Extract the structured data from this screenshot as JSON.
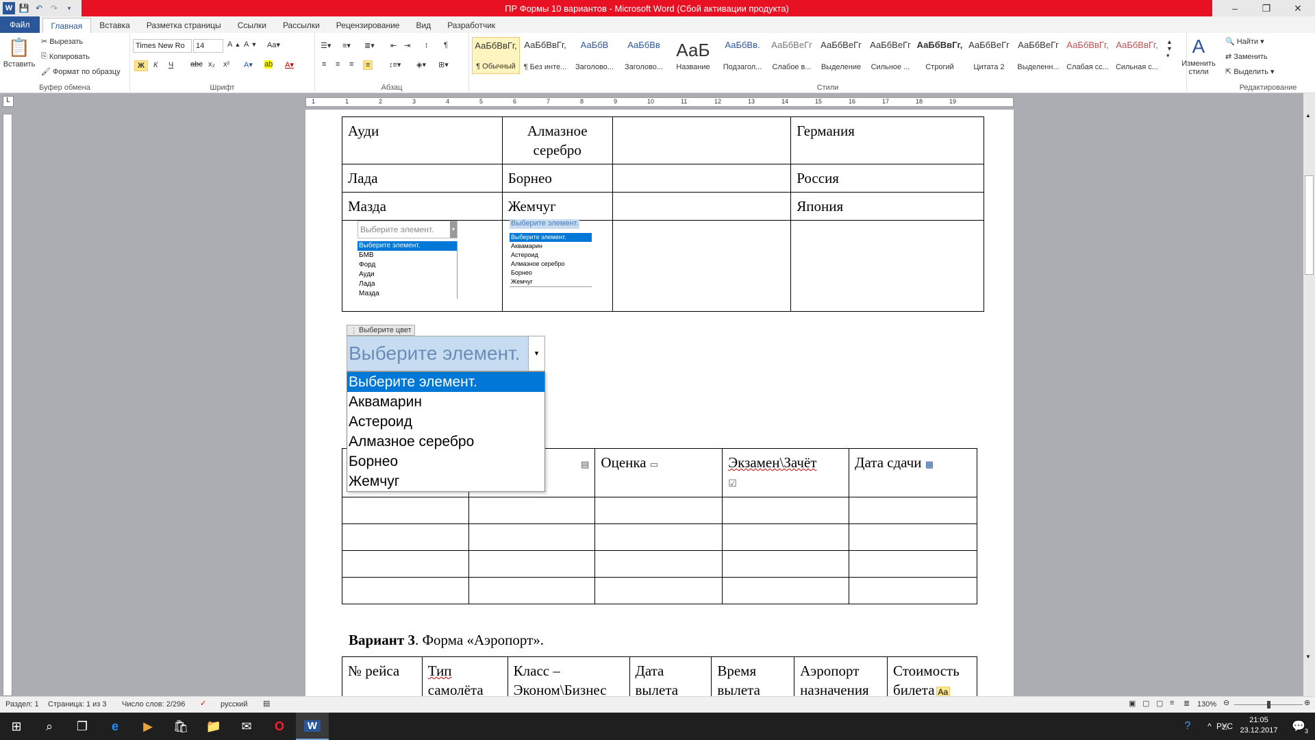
{
  "window": {
    "title": "ПР Формы 10 вариантов  -  Microsoft Word (Сбой активации продукта)",
    "minimize": "–",
    "restore": "❐",
    "close": "✕"
  },
  "tabs": [
    "Файл",
    "Главная",
    "Вставка",
    "Разметка страницы",
    "Ссылки",
    "Рассылки",
    "Рецензирование",
    "Вид",
    "Разработчик"
  ],
  "clipboard": {
    "paste": "Вставить",
    "cut": "Вырезать",
    "copy": "Копировать",
    "format": "Формат по образцу",
    "label": "Буфер обмена"
  },
  "font": {
    "name": "Times New Ro",
    "size": "14",
    "label": "Шрифт",
    "bold": "Ж",
    "italic": "К",
    "underline": "Ч",
    "strike": "abc",
    "sub": "x₂",
    "sup": "x²"
  },
  "paragraph": {
    "label": "Абзац"
  },
  "styles": {
    "label": "Стили",
    "items": [
      {
        "preview": "АаБбВвГг,",
        "name": "¶ Обычный"
      },
      {
        "preview": "АаБбВвГг,",
        "name": "¶ Без инте..."
      },
      {
        "preview": "АаБбВ",
        "name": "Заголово..."
      },
      {
        "preview": "АаБбВв",
        "name": "Заголово..."
      },
      {
        "preview": "АаБ",
        "name": "Название"
      },
      {
        "preview": "АаБбВв.",
        "name": "Подзагол..."
      },
      {
        "preview": "АаБбВеГг",
        "name": "Слабое в..."
      },
      {
        "preview": "АаБбВеГг",
        "name": "Выделение"
      },
      {
        "preview": "АаБбВеГг",
        "name": "Сильное ..."
      },
      {
        "preview": "АаБбВвГг,",
        "name": "Строгий"
      },
      {
        "preview": "АаБбВеГг",
        "name": "Цитата 2"
      },
      {
        "preview": "АаБбВеГг",
        "name": "Выделенн..."
      },
      {
        "preview": "АаБбВвГг,",
        "name": "Слабая сс..."
      },
      {
        "preview": "АаБбВвГг,",
        "name": "Сильная с..."
      }
    ],
    "change": "Изменить стили"
  },
  "editing": {
    "label": "Редактирование",
    "find": "Найти",
    "replace": "Заменить",
    "select": "Выделить"
  },
  "ruler_numbers": [
    "1",
    "1",
    "2",
    "3",
    "4",
    "5",
    "6",
    "7",
    "8",
    "9",
    "10",
    "11",
    "12",
    "13",
    "14",
    "15",
    "16",
    "17",
    "18",
    "19"
  ],
  "table1": {
    "rows": [
      [
        "Ауди",
        "Алмазное серебро",
        "",
        "Германия"
      ],
      [
        "Лада",
        "Борнео",
        "",
        "Россия"
      ],
      [
        "Мазда",
        "Жемчуг",
        "",
        "Япония"
      ]
    ]
  },
  "small_dd1": {
    "placeholder": "Выберите элемент.",
    "items": [
      "Выберите элемент.",
      "БМВ",
      "Форд",
      "Ауди",
      "Лада",
      "Мазда"
    ]
  },
  "small_dd2": {
    "placeholder": "Выберите элемент.",
    "items": [
      "Выберите элемент.",
      "Аквамарин",
      "Астероид",
      "Алмазное серебро",
      "Борнео",
      "Жемчуг"
    ]
  },
  "big_dd": {
    "tag": "Выберите цвет",
    "placeholder": "Выберите элемент.",
    "items": [
      "Выберите элемент.",
      "Аквамарин",
      "Астероид",
      "Алмазное серебро",
      "Борнео",
      "Жемчуг"
    ]
  },
  "partial_text": "».",
  "table2": {
    "headers": [
      "",
      "",
      "Оценка",
      "Экзамен\\Зачёт",
      "Дата сдачи"
    ],
    "empty_rows": 4
  },
  "variant3": {
    "bold": "Вариант 3",
    "rest": ". Форма «Аэропорт»."
  },
  "table3": {
    "headers": [
      "№ рейса",
      "Тип самолёта",
      "Класс – Эконом\\Бизнес",
      "Дата вылета",
      "Время вылета",
      "Аэропорт назначения",
      "Стоимость билета"
    ],
    "icon_text": "Aa"
  },
  "status": {
    "section": "Раздел: 1",
    "page": "Страница: 1 из 3",
    "words": "Число слов: 2/296",
    "lang": "русский",
    "zoom": "130%"
  },
  "taskbar": {
    "lang": "РУС",
    "time": "21:05",
    "date": "23.12.2017",
    "notif": "3"
  }
}
